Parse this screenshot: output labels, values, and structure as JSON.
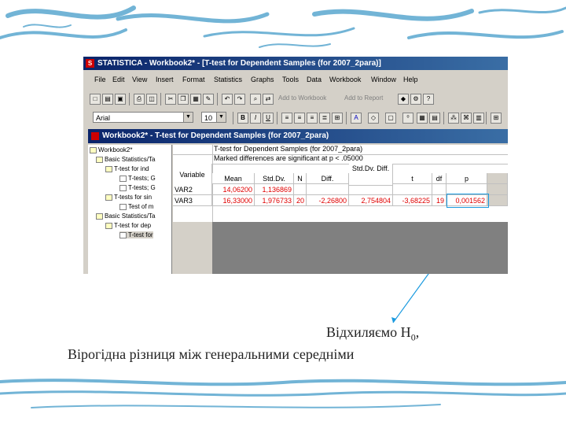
{
  "colors": {
    "accent_blue": "#1a9adf",
    "highlight_red": "#e00000",
    "decor": "#5aa7cf"
  },
  "app": {
    "title": "STATISTICA - Workbook2* - [T-test for Dependent Samples (for 2007_2para)]",
    "icon": "statistica-icon"
  },
  "menu": [
    "File",
    "Edit",
    "View",
    "Insert",
    "Format",
    "Statistics",
    "Graphs",
    "Tools",
    "Data",
    "Workbook",
    "Window",
    "Help"
  ],
  "toolbar": {
    "add_to_workbook": "Add to Workbook",
    "add_to_report": "Add to Report",
    "font_name": "Arial",
    "font_size": "10",
    "bold": "B",
    "italic": "I",
    "underline": "U"
  },
  "workbook": {
    "title": "Workbook2* - T-test for Dependent Samples (for 2007_2para)",
    "tree": [
      "Workbook2*",
      "Basic Statistics/Ta",
      "T-test for ind",
      "T-tests; G",
      "T-tests; G",
      "T-tests for sin",
      "Test of m",
      "Basic Statistics/Ta",
      "T-test for dep",
      "T-test for"
    ]
  },
  "results": {
    "header_line1": "T-test for Dependent Samples (for 2007_2para)",
    "header_line2": "Marked differences are significant at p < .05000",
    "columns": [
      "Variable",
      "Mean",
      "Std.Dv.",
      "N",
      "Diff.",
      "Std.Dv. Diff.",
      "t",
      "df",
      "p"
    ],
    "rows": [
      {
        "variable": "VAR2",
        "mean": "14,06200",
        "std": "1,136869",
        "n": "",
        "diff": "",
        "stddiff": "",
        "t": "",
        "df": "",
        "p": ""
      },
      {
        "variable": "VAR3",
        "mean": "16,33000",
        "std": "1,976733",
        "n": "20",
        "diff": "-2,26800",
        "stddiff": "2,754804",
        "t": "-3,68225",
        "df": "19",
        "p": "0,001562"
      }
    ]
  },
  "caption": {
    "line1": "Відхиляємо Н",
    "line1_sub": "0",
    "line1_end": ",",
    "line2": "Вірогідна різниця між генеральними середніми"
  }
}
